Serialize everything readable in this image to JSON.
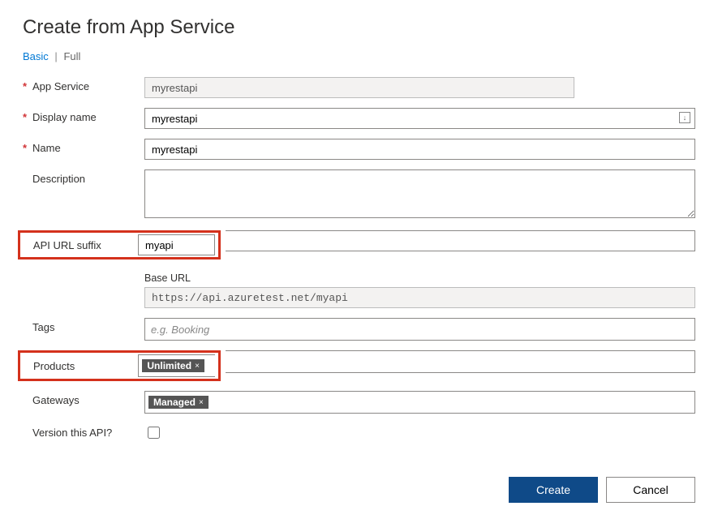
{
  "title": "Create from App Service",
  "mode": {
    "basic": "Basic",
    "full": "Full",
    "sep": "|"
  },
  "fields": {
    "app_service": {
      "label": "App Service",
      "value": "myrestapi",
      "required": true
    },
    "display_name": {
      "label": "Display name",
      "value": "myrestapi",
      "required": true,
      "icon": "↓"
    },
    "name": {
      "label": "Name",
      "value": "myrestapi",
      "required": true
    },
    "description": {
      "label": "Description",
      "value": ""
    },
    "api_url_suffix": {
      "label": "API URL suffix",
      "value": "myapi"
    },
    "base_url": {
      "label": "Base URL",
      "value": "https://api.azuretest.net/myapi"
    },
    "tags": {
      "label": "Tags",
      "placeholder": "e.g. Booking"
    },
    "products": {
      "label": "Products",
      "chips": [
        "Unlimited"
      ]
    },
    "gateways": {
      "label": "Gateways",
      "chips": [
        "Managed"
      ]
    },
    "version": {
      "label": "Version this API?",
      "checked": false
    }
  },
  "actions": {
    "create": "Create",
    "cancel": "Cancel"
  }
}
